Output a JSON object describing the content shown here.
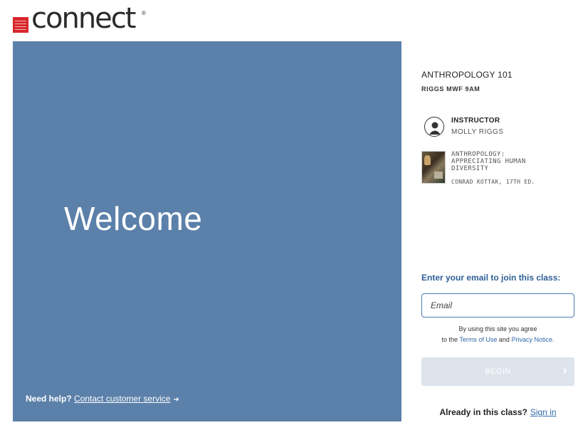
{
  "brand": {
    "logo_text": "connect",
    "registered": "®",
    "accent_color": "#d9262c"
  },
  "welcome": {
    "heading": "Welcome",
    "panel_color": "#5b80aa"
  },
  "help": {
    "prefix": "Need help?",
    "link": "Contact customer service",
    "arrow_icon": "arrow-right-icon"
  },
  "course": {
    "title": "ANTHROPOLOGY 101",
    "section": "RIGGS MWF 9AM"
  },
  "instructor": {
    "heading": "INSTRUCTOR",
    "name": "MOLLY RIGGS",
    "icon": "person-icon"
  },
  "textbook": {
    "title": "ANTHROPOLOGY: APPRECIATING HUMAN DIVERSITY",
    "author_edition": "CONRAD KOTTAK, 17TH ED."
  },
  "join": {
    "label": "Enter your email to join this class:",
    "email_placeholder": "Email",
    "terms_line1": "By using this site you agree",
    "terms_prefix": "to the",
    "terms_of_use": "Terms of Use",
    "terms_and": "and",
    "privacy_notice": "Privacy Notice.",
    "begin_label": "BEGIN",
    "begin_icon": "chevron-right-icon"
  },
  "signin": {
    "prompt": "Already in this class?",
    "link": "Sign in"
  }
}
